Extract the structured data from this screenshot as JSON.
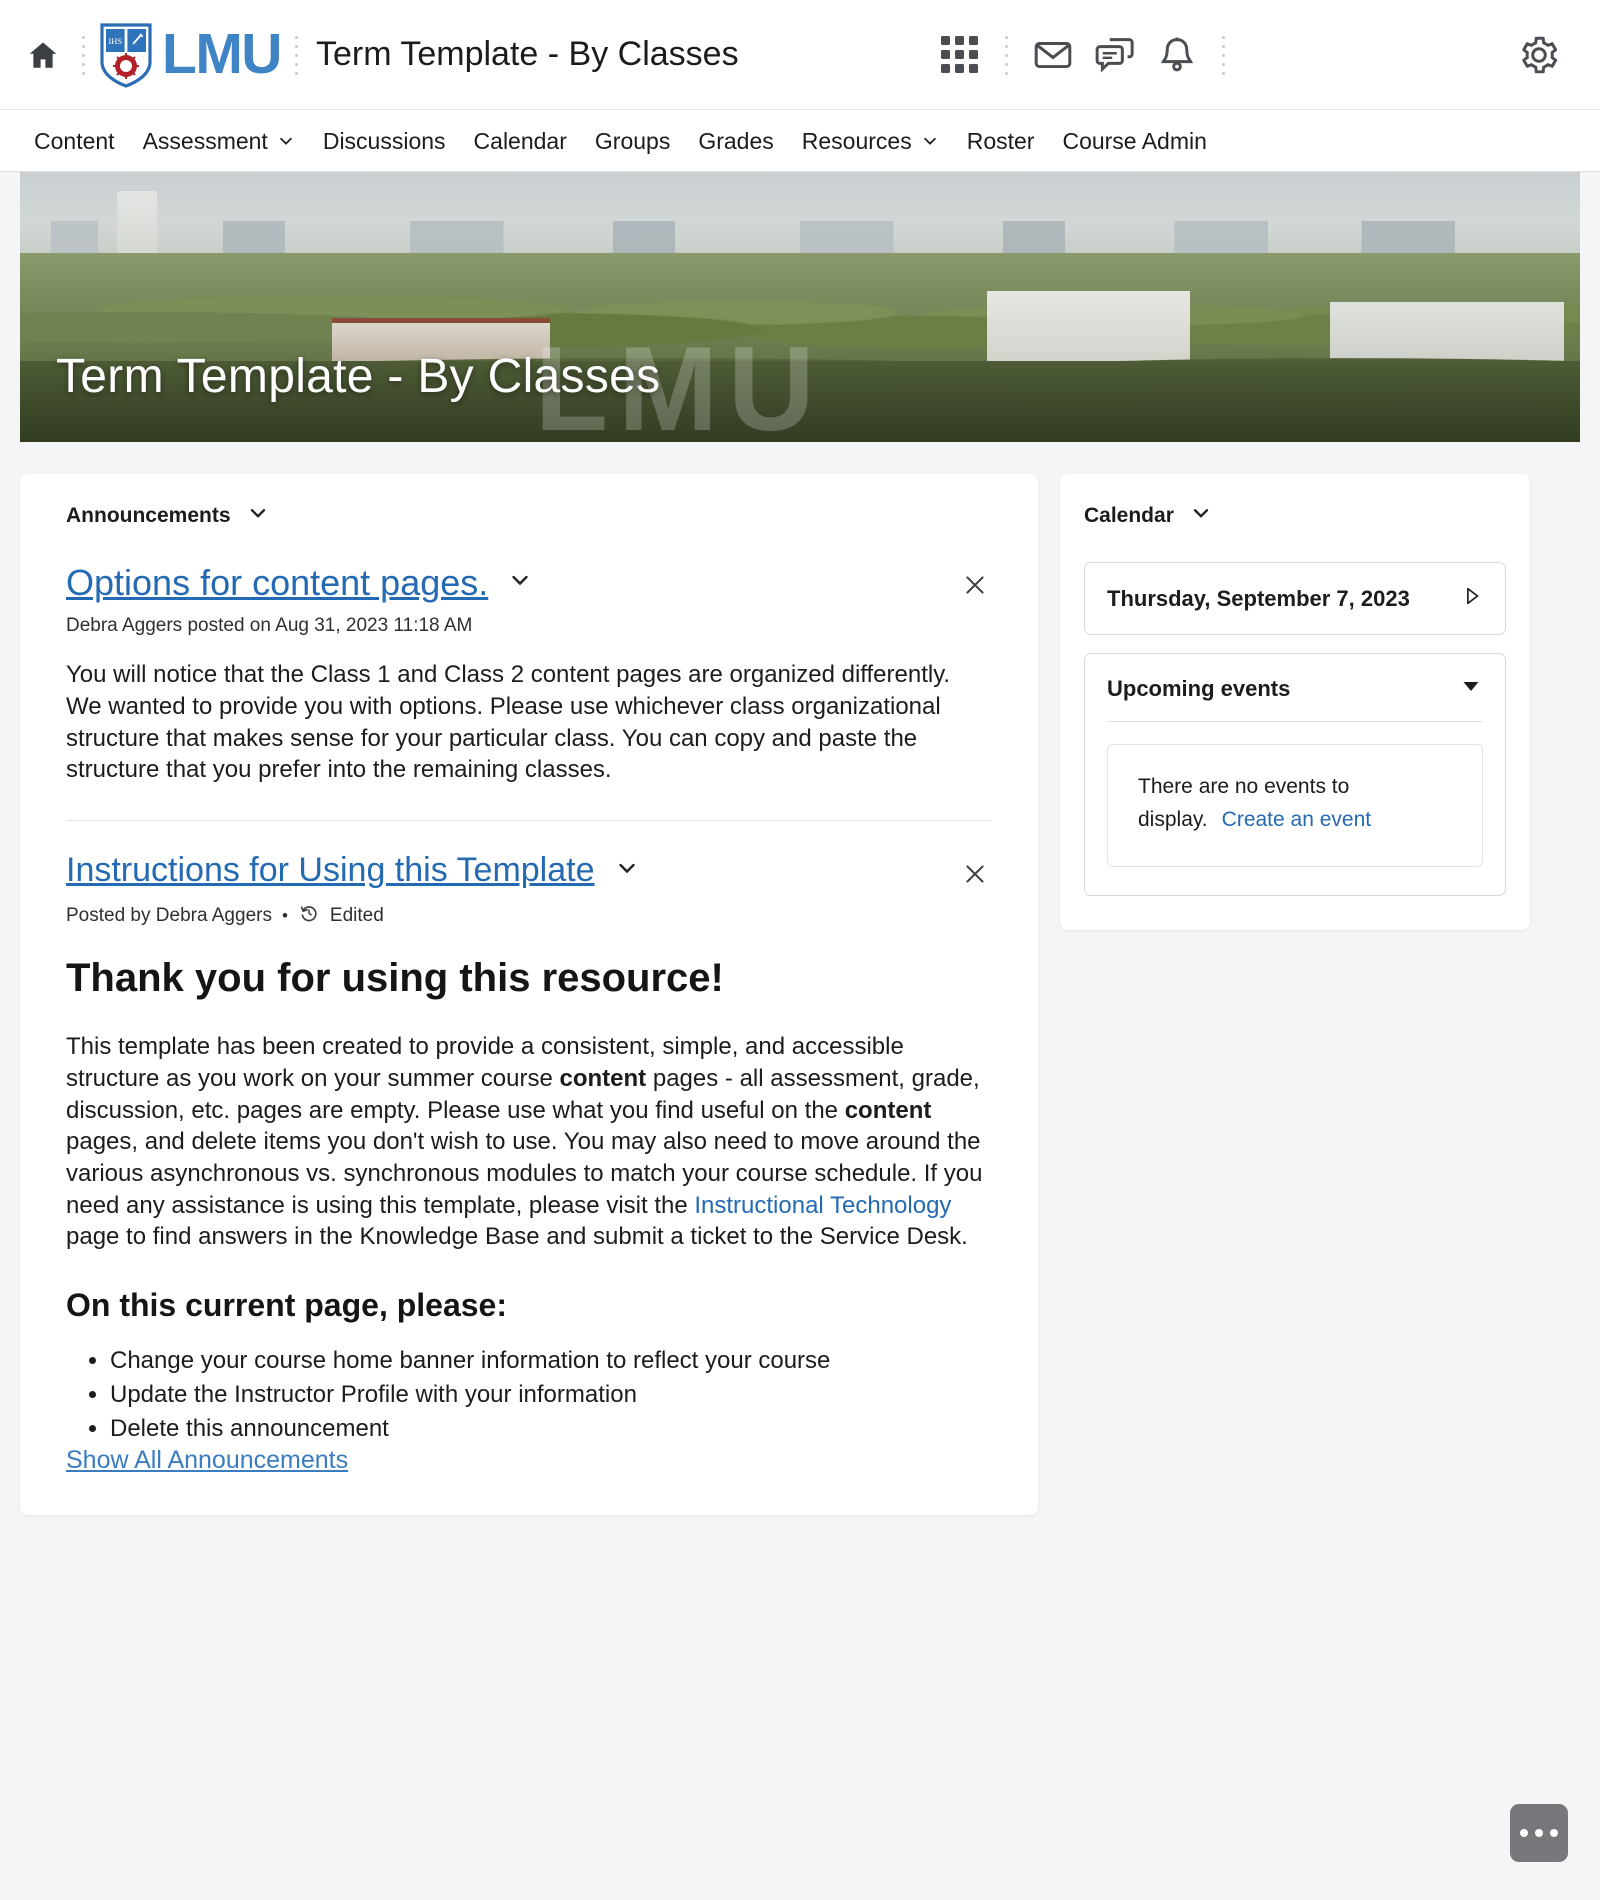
{
  "header": {
    "home_icon": "home-icon",
    "logo_text": "LMU",
    "logo_crest": "lmu-crest-icon",
    "course_title": "Term Template - By Classes",
    "icons": [
      {
        "name": "waffle-grid-icon",
        "label": "Course Selector"
      },
      {
        "name": "envelope-icon",
        "label": "Message Alerts"
      },
      {
        "name": "chat-bubble-icon",
        "label": "Subscription Alerts"
      },
      {
        "name": "bell-icon",
        "label": "Update Alerts"
      }
    ],
    "settings_icon": "gear-icon"
  },
  "nav": {
    "items": [
      {
        "label": "Content",
        "has_caret": false
      },
      {
        "label": "Assessment",
        "has_caret": true
      },
      {
        "label": "Discussions",
        "has_caret": false
      },
      {
        "label": "Calendar",
        "has_caret": false
      },
      {
        "label": "Groups",
        "has_caret": false
      },
      {
        "label": "Grades",
        "has_caret": false
      },
      {
        "label": "Resources",
        "has_caret": true
      },
      {
        "label": "Roster",
        "has_caret": false
      },
      {
        "label": "Course Admin",
        "has_caret": false
      }
    ]
  },
  "banner": {
    "title": "Term Template - By Classes",
    "watermark": "LMU"
  },
  "announcements": {
    "widget_title": "Announcements",
    "items": [
      {
        "title": "Options for content pages.",
        "meta": "Debra Aggers posted on Aug 31, 2023 11:18 AM",
        "body": "You will notice that the Class 1 and Class 2 content pages are organized differently. We wanted to provide you with options. Please use whichever class organizational structure that makes sense for your particular class. You can copy and paste the structure that you prefer into the remaining classes."
      },
      {
        "title": "Instructions for Using this Template",
        "meta_prefix": "Posted by Debra Aggers",
        "meta_bullet": "•",
        "meta_edited": "Edited",
        "edited_icon": "history-clock-icon",
        "heading": "Thank you for using this resource!",
        "para_1a": "This template has been created to provide a consistent, simple, and accessible structure as you work on your summer course ",
        "para_1b": "content",
        "para_1c": " pages - all assessment, grade, discussion, etc. pages are empty. Please use what you find useful on the ",
        "para_1d": "content",
        "para_1e": " pages, and delete items you don't wish to use. You may also need to move around the various asynchronous vs. synchronous modules to match your course schedule. If you need any assistance is using this template, please visit the ",
        "link_text": "Instructional Technology",
        "para_1f": " page to find answers in the Knowledge Base and submit a ticket to the Service Desk.",
        "subheading": "On this current page, please:",
        "bullets": [
          "Change your course home banner information to reflect your course",
          "Update the Instructor Profile with your information",
          "Delete this announcement"
        ]
      }
    ],
    "show_all_label": "Show All Announcements",
    "close_icon": "close-icon",
    "chevron_icon": "chevron-down-icon"
  },
  "calendar": {
    "widget_title": "Calendar",
    "selected_date": "Thursday, September 7, 2023",
    "next_icon": "play-triangle-icon",
    "upcoming_title": "Upcoming events",
    "collapse_icon": "triangle-down-icon",
    "empty_text": "There are no events to display.",
    "create_event_label": "Create an event"
  },
  "fab": {
    "name": "more-options-button",
    "label": "..."
  },
  "colors": {
    "link_blue": "#246ab3",
    "logo_blue": "#3f84c4",
    "page_bg": "#f4f5f7",
    "card_bg": "#ffffff"
  }
}
